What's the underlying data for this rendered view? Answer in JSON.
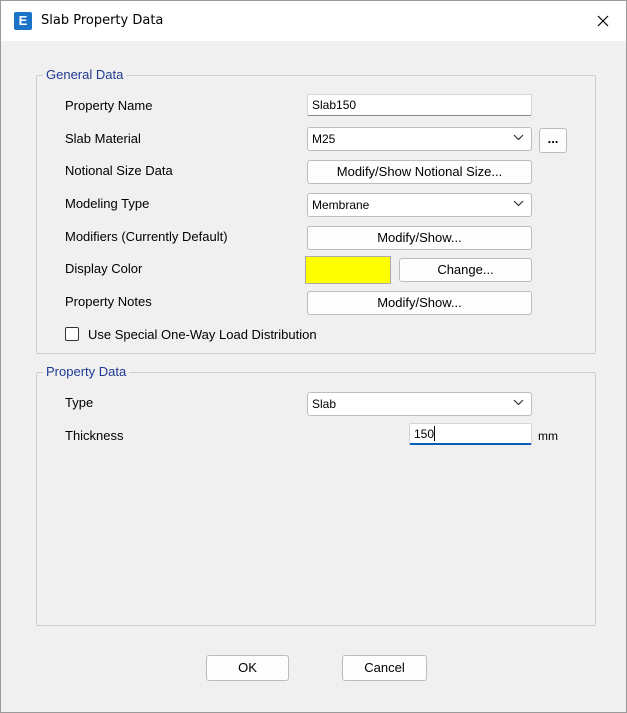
{
  "window": {
    "app_icon_letter": "E",
    "title": "Slab Property Data"
  },
  "general": {
    "title": "General Data",
    "property_name_label": "Property Name",
    "property_name_value": "Slab150",
    "slab_material_label": "Slab Material",
    "slab_material_value": "M25",
    "material_more_label": "...",
    "notional_label": "Notional Size Data",
    "notional_button": "Modify/Show Notional Size...",
    "modeling_type_label": "Modeling Type",
    "modeling_type_value": "Membrane",
    "modifiers_label": "Modifiers (Currently Default)",
    "modifiers_button": "Modify/Show...",
    "display_color_label": "Display Color",
    "display_color_value": "#ffff00",
    "change_button": "Change...",
    "notes_label": "Property Notes",
    "notes_button": "Modify/Show...",
    "one_way_label": "Use Special One-Way Load Distribution",
    "one_way_checked": false
  },
  "property": {
    "title": "Property Data",
    "type_label": "Type",
    "type_value": "Slab",
    "thickness_label": "Thickness",
    "thickness_value": "150",
    "thickness_unit": "mm"
  },
  "footer": {
    "ok_label": "OK",
    "cancel_label": "Cancel"
  }
}
